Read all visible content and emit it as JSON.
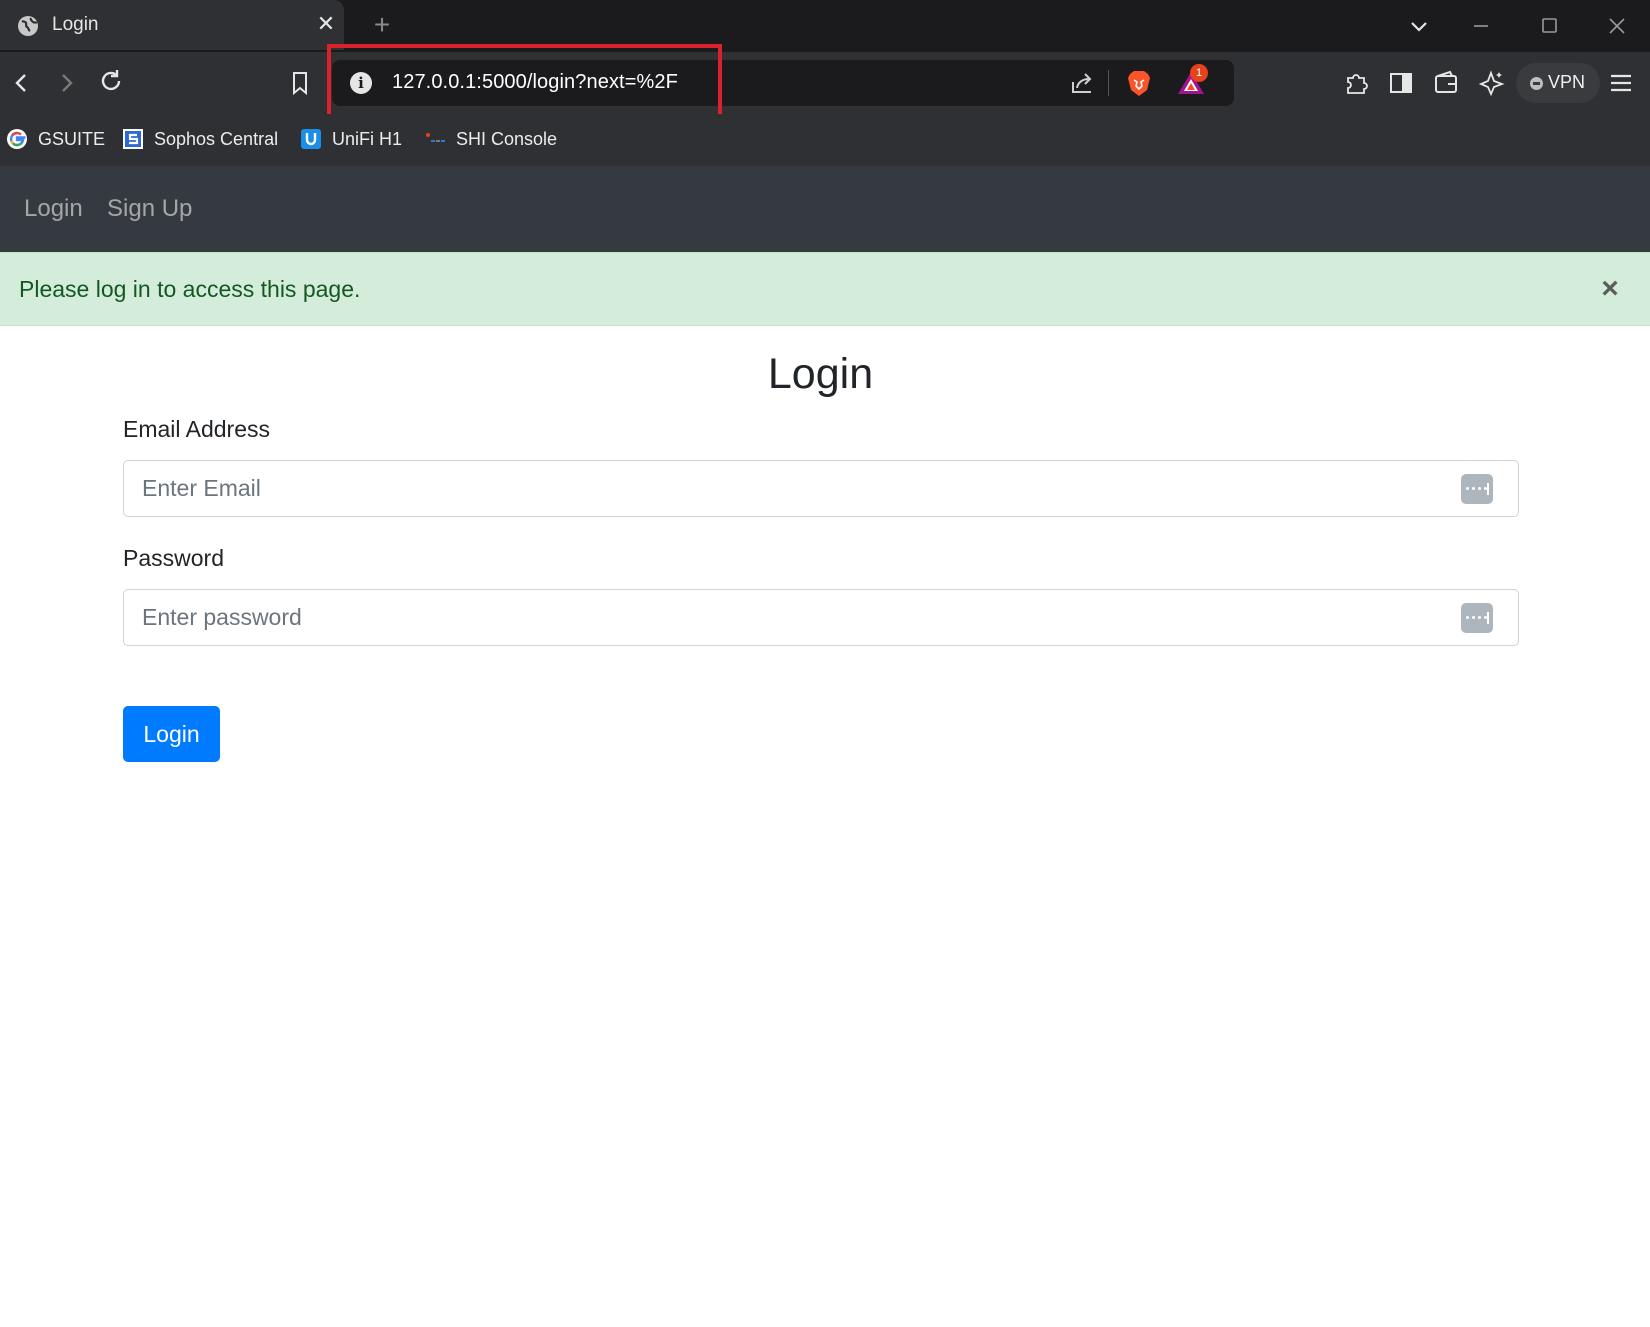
{
  "browser": {
    "tab": {
      "title": "Login",
      "close_glyph": "✕"
    },
    "new_tab_glyph": "+",
    "url": "127.0.0.1:5000/login?next=%2F",
    "vpn_label": "VPN",
    "rewards_badge": "1",
    "bookmarks": [
      {
        "label": "GSUITE",
        "icon": "google-icon"
      },
      {
        "label": "Sophos Central",
        "icon": "sophos-icon"
      },
      {
        "label": "UniFi H1",
        "icon": "unifi-icon"
      },
      {
        "label": "SHI Console",
        "icon": "shi-icon"
      }
    ],
    "accent_colors": {
      "highlight": "#d8232a",
      "brave": "#fb542b"
    }
  },
  "navbar": {
    "links": [
      "Login",
      "Sign Up"
    ]
  },
  "alert": {
    "message": "Please log in to access this page.",
    "close_glyph": "×",
    "background": "#d4edda",
    "text_color": "#155724"
  },
  "form": {
    "title": "Login",
    "email_label": "Email Address",
    "email_placeholder": "Enter Email",
    "password_label": "Password",
    "password_placeholder": "Enter password",
    "submit_label": "Login",
    "submit_color": "#007bff"
  }
}
